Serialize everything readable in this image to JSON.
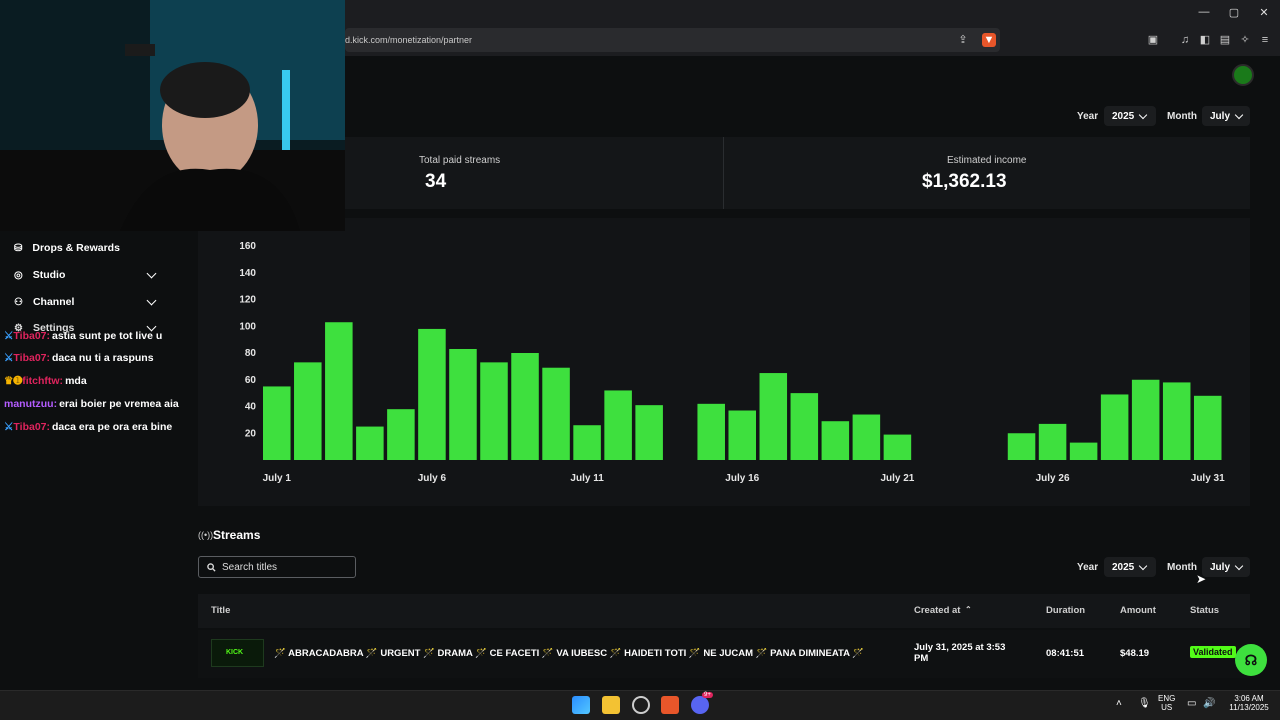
{
  "browser": {
    "url": "d.kick.com/monetization/partner",
    "window_controls": [
      "—",
      "▢",
      "✕"
    ]
  },
  "filters_top": {
    "year_label": "Year",
    "year_value": "2025",
    "month_label": "Month",
    "month_value": "July"
  },
  "stats": {
    "paid_streams_label": "Total paid streams",
    "paid_streams_value": "34",
    "income_label": "Estimated income",
    "income_value": "$1,362.13"
  },
  "chart_data": {
    "type": "bar",
    "ylim": [
      0,
      160
    ],
    "yticks": [
      20,
      40,
      60,
      80,
      100,
      120,
      140,
      160
    ],
    "xtick_labels": [
      {
        "day": 1,
        "label": "July 1"
      },
      {
        "day": 6,
        "label": "July 6"
      },
      {
        "day": 11,
        "label": "July 11"
      },
      {
        "day": 16,
        "label": "July 16"
      },
      {
        "day": 21,
        "label": "July 21"
      },
      {
        "day": 26,
        "label": "July 26"
      },
      {
        "day": 31,
        "label": "July 31"
      }
    ],
    "days": [
      1,
      2,
      3,
      4,
      5,
      6,
      7,
      8,
      9,
      10,
      11,
      12,
      13,
      14,
      15,
      16,
      17,
      18,
      19,
      20,
      21,
      22,
      23,
      24,
      25,
      26,
      27,
      28,
      29,
      30,
      31
    ],
    "values": [
      55,
      73,
      103,
      25,
      38,
      98,
      83,
      73,
      80,
      69,
      26,
      52,
      41,
      0,
      42,
      37,
      65,
      50,
      29,
      34,
      19,
      0,
      0,
      0,
      20,
      27,
      13,
      49,
      60,
      58,
      48
    ],
    "color": "#3ee03e"
  },
  "streams": {
    "title": "Streams",
    "search_placeholder": "Search titles",
    "filters": {
      "year_label": "Year",
      "year_value": "2025",
      "month_label": "Month",
      "month_value": "July"
    },
    "columns": {
      "title": "Title",
      "created": "Created at",
      "duration": "Duration",
      "amount": "Amount",
      "status": "Status"
    },
    "rows": [
      {
        "thumb_text": "KICK",
        "title": "🪄 ABRACADABRA 🪄 URGENT 🪄 DRAMA 🪄 CE FACETI 🪄 VA IUBESC 🪄 HAIDETI TOTI 🪄 NE JUCAM 🪄 PANA DIMINEATA 🪄",
        "created_line1": "July 31, 2025 at 3:53",
        "created_line2": "PM",
        "duration": "08:41:51",
        "amount": "$48.19",
        "status": "Validated"
      }
    ]
  },
  "sidebar": {
    "items": [
      {
        "label": "Drops & Rewards",
        "icon": "gift-icon"
      },
      {
        "label": "Studio",
        "icon": "studio-icon"
      },
      {
        "label": "Channel",
        "icon": "channel-icon"
      },
      {
        "label": "Settings",
        "icon": "gear-icon"
      }
    ]
  },
  "chat": [
    {
      "user": "Tiba07:",
      "text": "astia sunt pe tot live u",
      "color": "#e0245e",
      "badge": "sword"
    },
    {
      "user": "Tiba07:",
      "text": "daca nu ti a raspuns",
      "color": "#e0245e",
      "badge": "sword"
    },
    {
      "user": "fitchftw:",
      "text": "mda",
      "color": "#e0245e",
      "badge": "crown"
    },
    {
      "user": "manutzuu:",
      "text": "erai boier pe vremea aia",
      "color": "#b45cff",
      "badge": ""
    },
    {
      "user": "Tiba07:",
      "text": "daca era pe ora era bine",
      "color": "#e0245e",
      "badge": "sword"
    }
  ],
  "taskbar": {
    "lang_line1": "ENG",
    "lang_line2": "US",
    "time": "3:06 AM",
    "date": "11/13/2025",
    "discord_badge": "9+"
  },
  "colors": {
    "accent": "#53fc18",
    "bar": "#3ee03e",
    "panel": "#141618"
  }
}
